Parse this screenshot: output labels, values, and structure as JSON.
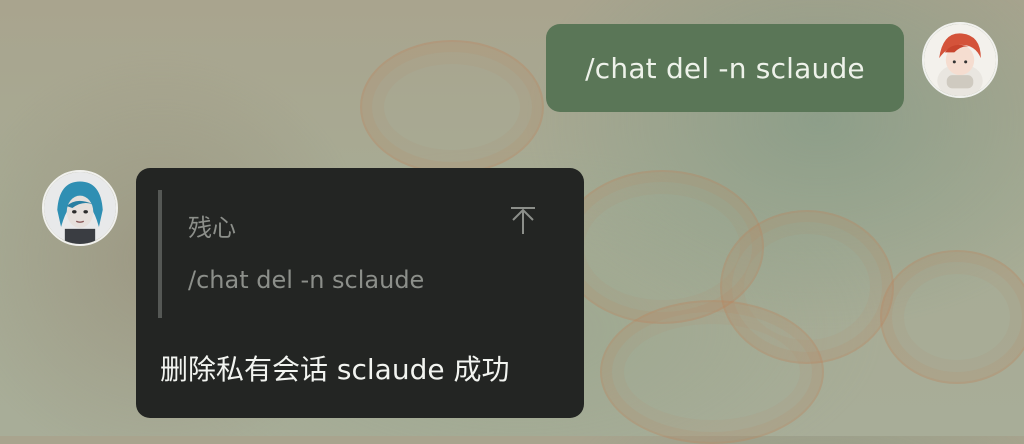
{
  "outgoing_message": {
    "text": "/chat del -n sclaude"
  },
  "incoming_message": {
    "quote": {
      "sender": "残心",
      "text": "/chat del -n sclaude"
    },
    "reply": "删除私有会话 sclaude 成功"
  },
  "icons": {
    "user_avatar": "user-avatar",
    "bot_avatar": "bot-avatar",
    "jump_to_original": "arrow-up-to-top-icon"
  },
  "colors": {
    "outgoing_bubble": "#5a7657",
    "incoming_bubble": "#232523",
    "quote_text": "#8c8f8a",
    "reply_text": "#f2f4f0"
  }
}
